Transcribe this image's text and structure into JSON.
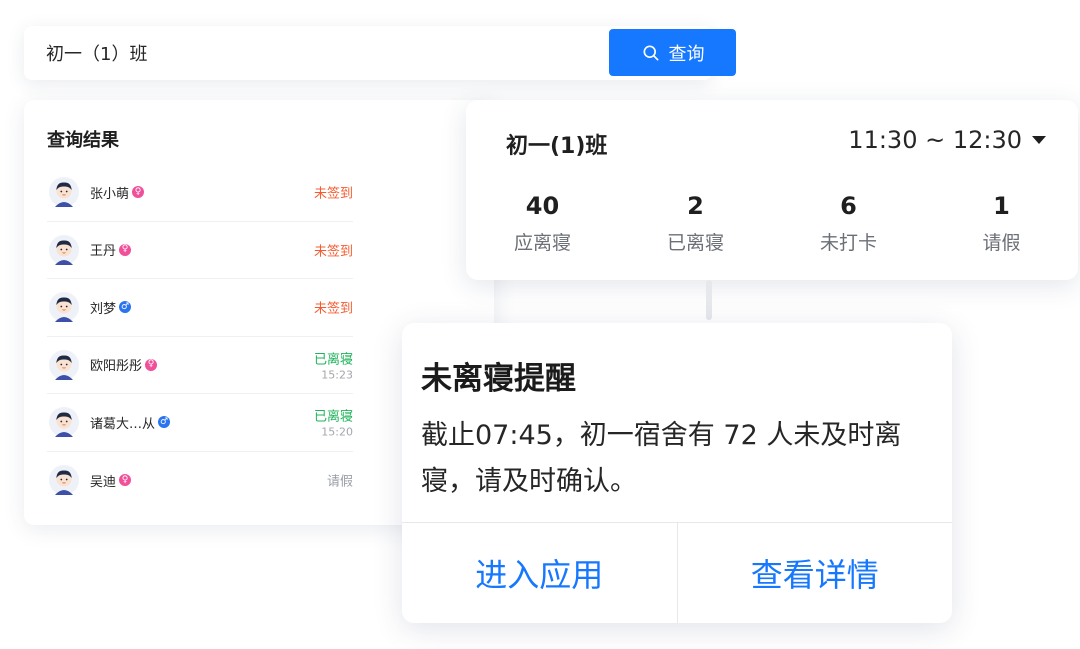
{
  "search": {
    "value": "初一（1）班",
    "button_label": "查询",
    "icon": "search-icon"
  },
  "results": {
    "title": "查询结果",
    "items": [
      {
        "name": "张小萌",
        "gender": "female",
        "gender_symbol": "♀",
        "status": "未签到",
        "status_type": "red",
        "time": ""
      },
      {
        "name": "王丹",
        "gender": "female",
        "gender_symbol": "♀",
        "status": "未签到",
        "status_type": "red",
        "time": ""
      },
      {
        "name": "刘梦",
        "gender": "male",
        "gender_symbol": "♂",
        "status": "未签到",
        "status_type": "red",
        "time": ""
      },
      {
        "name": "欧阳彤彤",
        "gender": "female",
        "gender_symbol": "♀",
        "status": "已离寝",
        "status_type": "green",
        "time": "15:23"
      },
      {
        "name": "诸葛大…从",
        "gender": "male",
        "gender_symbol": "♂",
        "status": "已离寝",
        "status_type": "green",
        "time": "15:20"
      },
      {
        "name": "吴迪",
        "gender": "female",
        "gender_symbol": "♀",
        "status": "请假",
        "status_type": "gray",
        "time": ""
      }
    ]
  },
  "summary": {
    "class_name": "初一(1)班",
    "time_range": "11:30 ~ 12:30",
    "stats": [
      {
        "value": "40",
        "label": "应离寝"
      },
      {
        "value": "2",
        "label": "已离寝"
      },
      {
        "value": "6",
        "label": "未打卡"
      },
      {
        "value": "1",
        "label": "请假"
      }
    ]
  },
  "alert": {
    "title": "未离寝提醒",
    "body": "截止07:45，初一宿舍有 72 人未及时离寝，请及时确认。",
    "actions": [
      "进入应用",
      "查看详情"
    ]
  },
  "colors": {
    "primary": "#1677ff",
    "status_red": "#f55b2f",
    "status_green": "#1fb35b",
    "status_gray": "#9a9ea5",
    "female": "#f0509a",
    "male": "#2a74f0"
  }
}
